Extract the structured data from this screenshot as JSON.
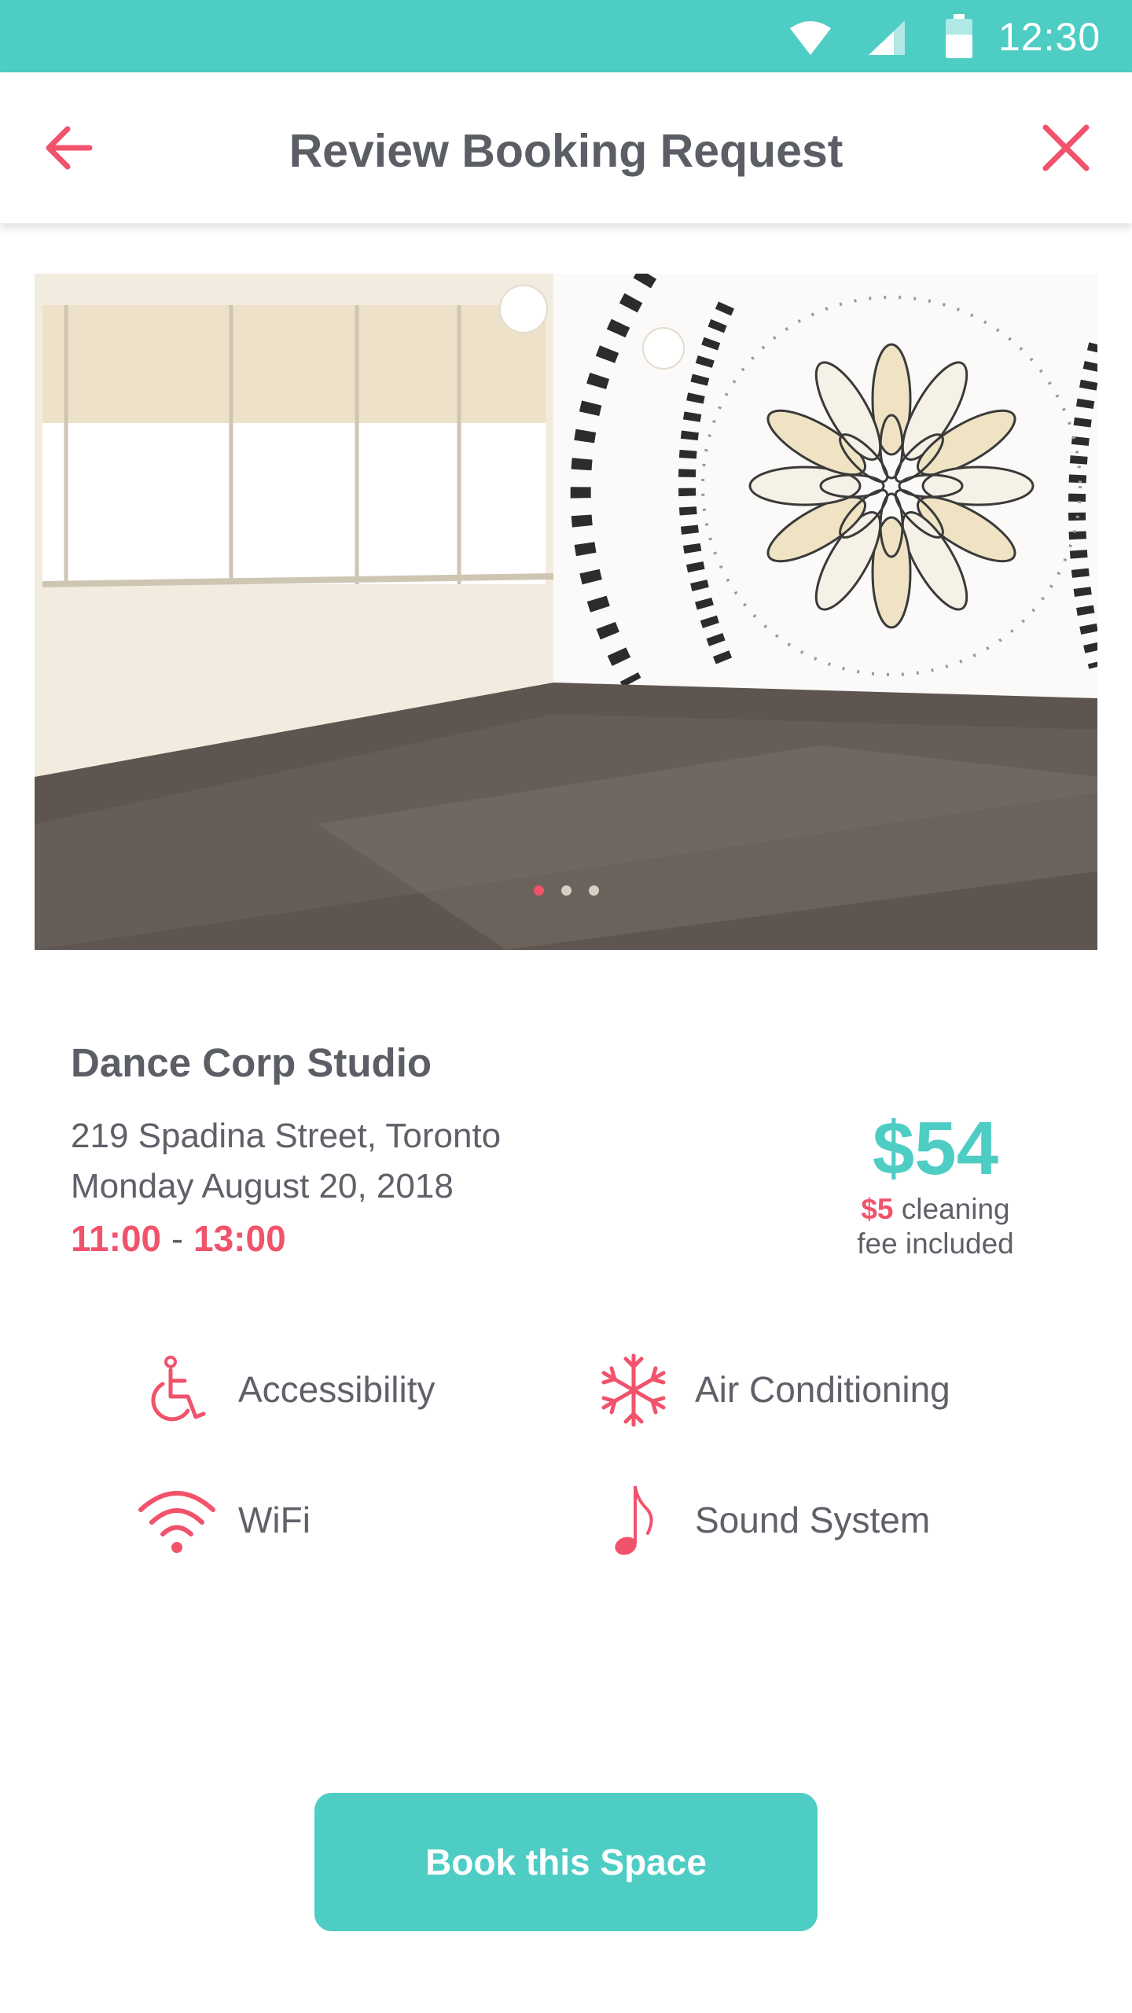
{
  "status_bar": {
    "time": "12:30",
    "icons": [
      "wifi-icon",
      "cell-signal-icon",
      "battery-icon"
    ]
  },
  "app_bar": {
    "title": "Review Booking Request",
    "back_icon": "arrow-left-icon",
    "close_icon": "close-icon"
  },
  "gallery": {
    "image": "dance studio room photo",
    "slide_count": 3,
    "active_slide": 1
  },
  "listing": {
    "name": "Dance Corp Studio",
    "address": "219 Spadina Street, Toronto",
    "date": "Monday August 20, 2018",
    "start_time": "11:00",
    "time_separator": " - ",
    "end_time": "13:00",
    "price": "$54",
    "fee_amount": "$5",
    "fee_text_1": " cleaning",
    "fee_text_2": "fee included"
  },
  "amenities": [
    {
      "label": "Accessibility",
      "icon": "accessibility-icon"
    },
    {
      "label": "Air Conditioning",
      "icon": "snowflake-icon"
    },
    {
      "label": "WiFi",
      "icon": "wifi-icon"
    },
    {
      "label": "Sound System",
      "icon": "music-note-icon"
    }
  ],
  "actions": {
    "book_label": "Book this Space"
  },
  "colors": {
    "accent_teal": "#4ecdc4",
    "accent_coral": "#f0536b",
    "text_dark": "#5c5e66"
  }
}
